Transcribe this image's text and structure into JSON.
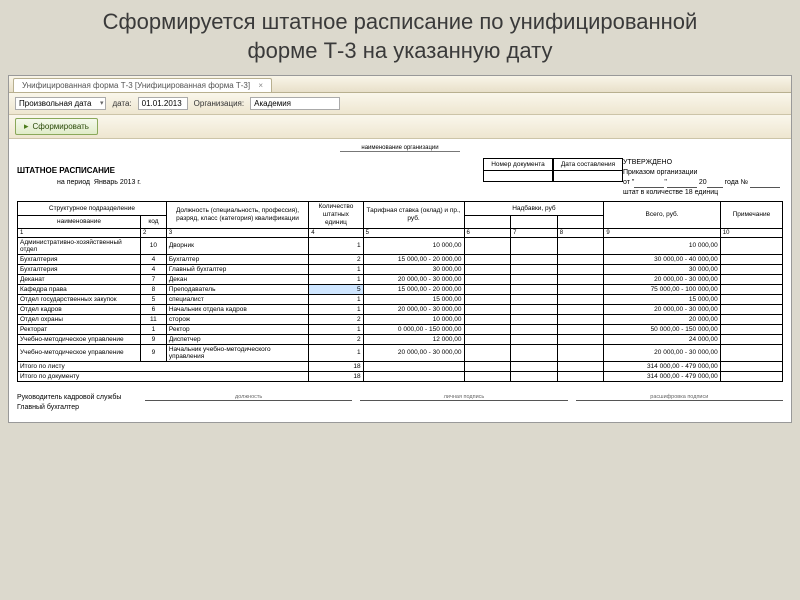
{
  "slide_title_line1": "Сформируется штатное расписание по унифицированной",
  "slide_title_line2": "форме Т-3 на указанную дату",
  "tab": {
    "label": "Унифицированная форма Т-3 [Унифицированная форма Т-3]",
    "close": "×"
  },
  "toolbar": {
    "mode_label": "",
    "mode_value": "Произвольная дата",
    "date_label": "дата:",
    "date_value": "01.01.2013",
    "org_label": "Организация:",
    "org_value": "Академия"
  },
  "button_form": "Сформировать",
  "org_caption": "наименование организации",
  "mini_hdr": {
    "doc_no": "Номер документа",
    "date": "Дата составления"
  },
  "doc_title": "ШТАТНОЕ РАСПИСАНИЕ",
  "period_prefix": "на период",
  "period_value": "Январь 2013 г.",
  "approved": {
    "title": "УТВЕРЖДЕНО",
    "line1": "Приказом организации",
    "from": "от \"",
    "year_suffix": "20",
    "year_end": "года №",
    "staff": "штат в количестве 18 единиц"
  },
  "headers": {
    "dept": "Структурное подразделение",
    "dept_name": "наименование",
    "dept_code": "код",
    "position": "Должность (специальность, профессия), разряд, класс (категория) квалификации",
    "units": "Количество штатных единиц",
    "rate": "Тарифная ставка (оклад) и пр., руб.",
    "allowance": "Надбавки, руб",
    "total": "Всего, руб.",
    "note": "Примечание"
  },
  "colnums": [
    "1",
    "2",
    "3",
    "4",
    "5",
    "6",
    "7",
    "8",
    "9",
    "10"
  ],
  "rows": [
    {
      "dept": "Административно-хозяйственный отдел",
      "code": "10",
      "pos": "Дворник",
      "units": "1",
      "rate": "10 000,00",
      "total": "10 000,00"
    },
    {
      "dept": "Бухгалтерия",
      "code": "4",
      "pos": "Бухгалтер",
      "units": "2",
      "rate": "15 000,00 - 20 000,00",
      "total": "30 000,00 - 40 000,00"
    },
    {
      "dept": "Бухгалтерия",
      "code": "4",
      "pos": "Главный бухгалтер",
      "units": "1",
      "rate": "30 000,00",
      "total": "30 000,00"
    },
    {
      "dept": "Деканат",
      "code": "7",
      "pos": "Декан",
      "units": "1",
      "rate": "20 000,00 - 30 000,00",
      "total": "20 000,00 - 30 000,00"
    },
    {
      "dept": "Кафедра права",
      "code": "8",
      "pos": "Преподаватель",
      "units": "5",
      "rate": "15 000,00 - 20 000,00",
      "total": "75 000,00 - 100 000,00",
      "sel": true
    },
    {
      "dept": "Отдел государственных закупок",
      "code": "5",
      "pos": "специалист",
      "units": "1",
      "rate": "15 000,00",
      "total": "15 000,00"
    },
    {
      "dept": "Отдел кадров",
      "code": "6",
      "pos": "Начальник отдела кадров",
      "units": "1",
      "rate": "20 000,00 - 30 000,00",
      "total": "20 000,00 - 30 000,00"
    },
    {
      "dept": "Отдел охраны",
      "code": "11",
      "pos": "сторож",
      "units": "2",
      "rate": "10 000,00",
      "total": "20 000,00"
    },
    {
      "dept": "Ректорат",
      "code": "1",
      "pos": "Ректор",
      "units": "1",
      "rate": "0 000,00 - 150 000,00",
      "total": "50 000,00 - 150 000,00"
    },
    {
      "dept": "Учебно-методическое управление",
      "code": "9",
      "pos": "Диспетчер",
      "units": "2",
      "rate": "12 000,00",
      "total": "24 000,00"
    },
    {
      "dept": "Учебно-методическое управление",
      "code": "9",
      "pos": "Начальник учебно-методического управления",
      "units": "1",
      "rate": "20 000,00 - 30 000,00",
      "total": "20 000,00 - 30 000,00"
    }
  ],
  "totals": {
    "sheet_label": "Итого по листу",
    "sheet_units": "18",
    "sheet_total": "314 000,00 - 479 000,00",
    "doc_label": "Итого по документу",
    "doc_units": "18",
    "doc_total": "314 000,00 - 479 000,00"
  },
  "sig": {
    "hr": "Руководитель кадровой службы",
    "acc": "Главный бухгалтер",
    "pos": "должность",
    "sign": "личная подпись",
    "name": "расшифровка подписи"
  }
}
